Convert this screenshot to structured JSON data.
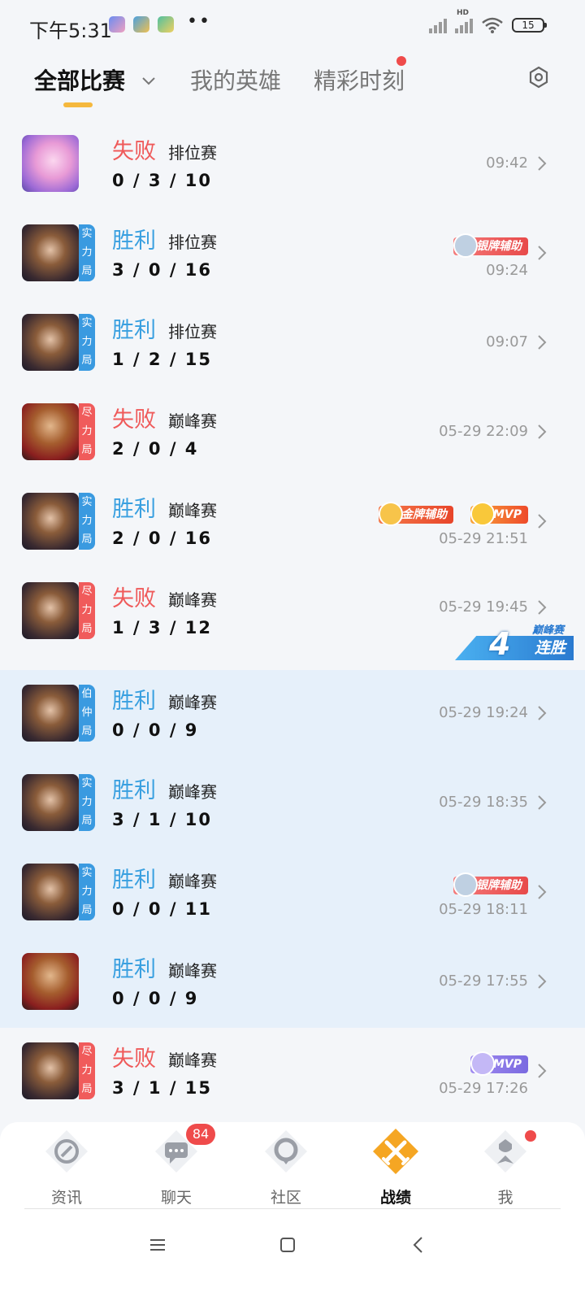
{
  "status_bar": {
    "time": "下午5:31",
    "more": "••",
    "hd_label": "HD",
    "battery": "15"
  },
  "tabs": {
    "all_matches": "全部比赛",
    "my_heroes": "我的英雄",
    "highlights": "精彩时刻"
  },
  "matches": [
    {
      "result": "失败",
      "mode": "排位赛",
      "kda": "0 / 3 / 10",
      "time": "09:42"
    },
    {
      "result": "胜利",
      "mode": "排位赛",
      "kda": "3 / 0 / 16",
      "time": "09:24",
      "badge": [
        "实",
        "力",
        "局"
      ],
      "tags": [
        "银牌辅助"
      ]
    },
    {
      "result": "胜利",
      "mode": "排位赛",
      "kda": "1 / 2 / 15",
      "time": "09:07",
      "badge": [
        "实",
        "力",
        "局"
      ]
    },
    {
      "result": "失败",
      "mode": "巅峰赛",
      "kda": "2 / 0 / 4",
      "time": "05-29 22:09",
      "badge": [
        "尽",
        "力",
        "局"
      ]
    },
    {
      "result": "胜利",
      "mode": "巅峰赛",
      "kda": "2 / 0 / 16",
      "time": "05-29 21:51",
      "badge": [
        "实",
        "力",
        "局"
      ],
      "tags": [
        "金牌辅助",
        "MVP"
      ]
    },
    {
      "result": "失败",
      "mode": "巅峰赛",
      "kda": "1 / 3 / 12",
      "time": "05-29 19:45",
      "badge": [
        "尽",
        "力",
        "局"
      ]
    },
    {
      "result": "胜利",
      "mode": "巅峰赛",
      "kda": "0 / 0 / 9",
      "time": "05-29 19:24",
      "badge": [
        "伯",
        "仲",
        "局"
      ]
    },
    {
      "result": "胜利",
      "mode": "巅峰赛",
      "kda": "3 / 1 / 10",
      "time": "05-29 18:35",
      "badge": [
        "实",
        "力",
        "局"
      ]
    },
    {
      "result": "胜利",
      "mode": "巅峰赛",
      "kda": "0 / 0 / 11",
      "time": "05-29 18:11",
      "badge": [
        "实",
        "力",
        "局"
      ],
      "tags": [
        "银牌辅助"
      ]
    },
    {
      "result": "胜利",
      "mode": "巅峰赛",
      "kda": "0 / 0 / 9",
      "time": "05-29 17:55"
    },
    {
      "result": "失败",
      "mode": "巅峰赛",
      "kda": "3 / 1 / 15",
      "time": "05-29 17:26",
      "badge": [
        "尽",
        "力",
        "局"
      ],
      "tags": [
        "MVP"
      ]
    }
  ],
  "streak": {
    "mode": "巅峰赛",
    "count": "4",
    "label": "连胜"
  },
  "bottom_nav": {
    "news": "资讯",
    "chat": "聊天",
    "chat_badge": "84",
    "community": "社区",
    "records": "战绩",
    "me": "我"
  },
  "colors": {
    "win": "#3aa0e0",
    "lose": "#ef5a5a",
    "accent": "#f5b83d",
    "highlight_bg": "#e6f0fa"
  },
  "icons": [
    "chevron-down-icon",
    "settings-hexagon-icon",
    "chevron-right-icon",
    "news-icon",
    "chat-icon",
    "community-icon",
    "records-icon",
    "me-icon",
    "menu-icon",
    "home-icon",
    "back-icon"
  ]
}
